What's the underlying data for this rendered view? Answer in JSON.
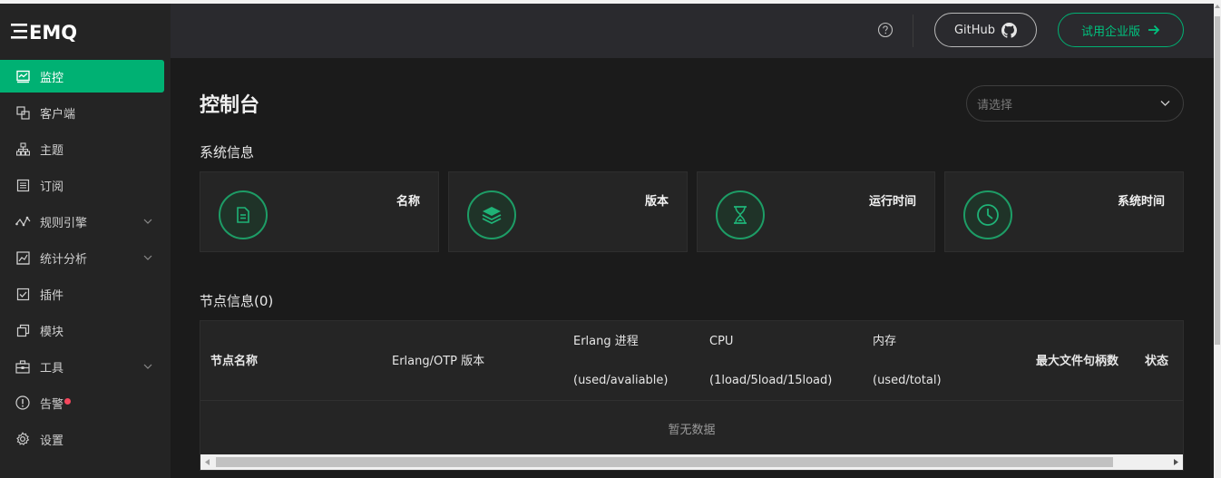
{
  "app": {
    "logo_text": "EMQ"
  },
  "sidebar": {
    "items": [
      {
        "label": "监控",
        "icon": "monitor-icon",
        "active": true
      },
      {
        "label": "客户端",
        "icon": "clients-icon"
      },
      {
        "label": "主题",
        "icon": "topics-icon"
      },
      {
        "label": "订阅",
        "icon": "subscriptions-icon"
      },
      {
        "label": "规则引擎",
        "icon": "rule-engine-icon",
        "expandable": true
      },
      {
        "label": "统计分析",
        "icon": "analysis-icon",
        "expandable": true
      },
      {
        "label": "插件",
        "icon": "plugins-icon"
      },
      {
        "label": "模块",
        "icon": "modules-icon"
      },
      {
        "label": "工具",
        "icon": "tools-icon",
        "expandable": true
      },
      {
        "label": "告警",
        "icon": "alarm-icon",
        "badge": "red-dot"
      },
      {
        "label": "设置",
        "icon": "settings-icon"
      }
    ]
  },
  "header": {
    "help_icon": "question-circle-icon",
    "github_label": "GitHub",
    "enterprise_label": "试用企业版"
  },
  "main": {
    "title": "控制台",
    "node_select_placeholder": "请选择",
    "system_info_title": "系统信息",
    "cards": [
      {
        "label": "名称",
        "icon": "document-icon"
      },
      {
        "label": "版本",
        "icon": "layers-icon"
      },
      {
        "label": "运行时间",
        "icon": "hourglass-icon"
      },
      {
        "label": "系统时间",
        "icon": "clock-icon"
      }
    ],
    "node_info_title": "节点信息(0)",
    "table": {
      "col_node_name": "节点名称",
      "col_otp_version": "Erlang/OTP 版本",
      "col_erlang_proc": "Erlang 进程",
      "col_erlang_proc_sub": "(used/avaliable)",
      "col_cpu": "CPU",
      "col_cpu_sub": "(1load/5load/15load)",
      "col_memory": "内存",
      "col_memory_sub": "(used/total)",
      "col_max_fds": "最大文件句柄数",
      "col_status": "状态",
      "empty_text": "暂无数据"
    }
  },
  "colors": {
    "accent": "#00b173",
    "badge_red": "#f5475d"
  }
}
